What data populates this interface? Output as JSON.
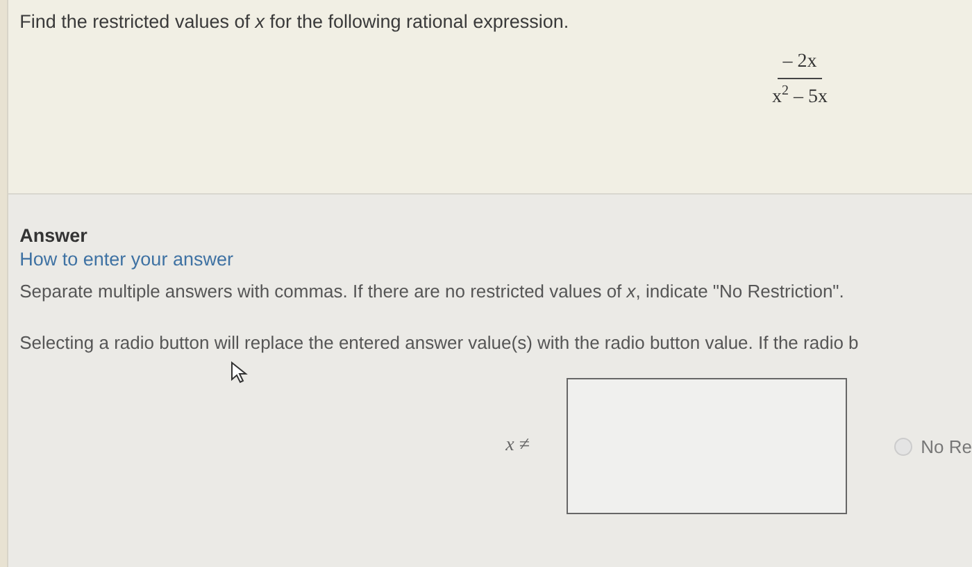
{
  "question": {
    "prompt": "Find the restricted values of *x* for the following rational expression.",
    "numerator": "– 2x",
    "denominator": "x$^{2}$ – 5x"
  },
  "answer": {
    "heading": "Answer",
    "help_link": "How to enter your answer",
    "instructions": "Separate multiple answers with commas. If there are no restricted values of *x*, indicate \"No Restriction\".",
    "radio_note": "Selecting a radio button will replace the entered answer value(s) with the radio button value. If the radio b",
    "input_label": "*x* ≠",
    "options": [
      {
        "label": "No Re",
        "selected": false
      }
    ]
  }
}
